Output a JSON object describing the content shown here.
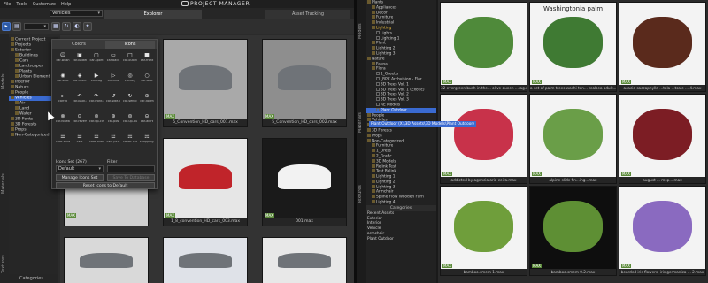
{
  "menu": [
    "File",
    "Tools",
    "Customize",
    "Help"
  ],
  "app_title": "PROJECT MANAGER",
  "tabs": [
    "Explorer",
    "Asset Tracking"
  ],
  "toolbar": {
    "project_select": "Vehicles",
    "action_glyph": "↻"
  },
  "side_tabs": {
    "models": "Models",
    "materials": "Materials",
    "textures": "Textures"
  },
  "left_tree": [
    {
      "label": "Current Project",
      "level": 0
    },
    {
      "label": "Projects",
      "level": 0
    },
    {
      "label": "Exterior",
      "level": 0
    },
    {
      "label": "Buildings",
      "level": 1
    },
    {
      "label": "Cars",
      "level": 1
    },
    {
      "label": "Landscapes",
      "level": 1
    },
    {
      "label": "Plants",
      "level": 1
    },
    {
      "label": "Urban Element",
      "level": 1
    },
    {
      "label": "Interior",
      "level": 0
    },
    {
      "label": "Nature",
      "level": 0
    },
    {
      "label": "People",
      "level": 0
    },
    {
      "label": "Vehicles",
      "level": 0,
      "selected": true
    },
    {
      "label": "Air",
      "level": 1
    },
    {
      "label": "Land",
      "level": 1
    },
    {
      "label": "Water",
      "level": 1
    },
    {
      "label": "3D Fonts",
      "level": 0
    },
    {
      "label": "3D Forests",
      "level": 0
    },
    {
      "label": "Props",
      "level": 0
    },
    {
      "label": "Non-Categorized",
      "level": 0
    }
  ],
  "icons_popup": {
    "tabs": [
      "Colors",
      "Icons"
    ],
    "cells": [
      {
        "g": "☺",
        "l": "car-wash"
      },
      {
        "g": "▣",
        "l": "car-battery"
      },
      {
        "g": "▢",
        "l": "car-sport"
      },
      {
        "g": "▭",
        "l": "car-back"
      },
      {
        "g": "□",
        "l": "car-outline"
      },
      {
        "g": "■",
        "l": "car-front"
      },
      {
        "g": "◉",
        "l": "car-side"
      },
      {
        "g": "◈",
        "l": "car-multi"
      },
      {
        "g": "▶",
        "l": "car-cog"
      },
      {
        "g": "▷",
        "l": "car-info"
      },
      {
        "g": "◎",
        "l": "car-key"
      },
      {
        "g": "○",
        "l": "car-sale"
      },
      {
        "g": "▸",
        "l": "carrot"
      },
      {
        "g": "↶",
        "l": "car-back-circle"
      },
      {
        "g": "↷",
        "l": "car-front-circle"
      },
      {
        "g": "↺",
        "l": "car-side-circle"
      },
      {
        "g": "↻",
        "l": "car-sett-circle"
      },
      {
        "g": "⊕",
        "l": "car-down"
      },
      {
        "g": "⊗",
        "l": "car-forward"
      },
      {
        "g": "⊙",
        "l": "car-reverse"
      },
      {
        "g": "⊚",
        "l": "car-up-circle"
      },
      {
        "g": "⊛",
        "l": "car-pos"
      },
      {
        "g": "⊜",
        "l": "car-up-outline"
      },
      {
        "g": "⊝",
        "l": "car-alert"
      },
      {
        "g": "☰",
        "l": "card-bullets"
      },
      {
        "g": "☱",
        "l": "cart"
      },
      {
        "g": "☲",
        "l": "card-outline"
      },
      {
        "g": "☳",
        "l": "cart-plus"
      },
      {
        "g": "☴",
        "l": "credit-card"
      },
      {
        "g": "☵",
        "l": "shopping-cart"
      }
    ],
    "icon_set_label": "Icons Set (267)",
    "icon_set_value": "Default",
    "filter_label": "Filter",
    "manage_button": "Manage Icons Set",
    "save_button": "Save To Database",
    "reset_button": "Reset Icons to Default"
  },
  "left_thumbs": [
    {
      "fn": "",
      "badge": "MAX",
      "tone": "#b9b9b9"
    },
    {
      "fn": "5_Convention_HD_cars_001.max",
      "badge": "MAX",
      "tone": "#a9a9a9"
    },
    {
      "fn": "5_Convention_HD_cars_002.max",
      "badge": "MAX",
      "tone": "#8e8e8e"
    },
    {
      "fn": "",
      "badge": "MAX",
      "tone": "#d0d0d0"
    },
    {
      "fn": "1_8_convention_HD_cars_003.max",
      "badge": "MAX",
      "tone": "#e6e6e6"
    },
    {
      "fn": "001.max",
      "badge": "MAX",
      "tone": "#1a1a1a"
    },
    {
      "fn": "",
      "badge": "",
      "tone": "#d9d9d9"
    },
    {
      "fn": "",
      "badge": "",
      "tone": "#dfe2e8"
    },
    {
      "fn": "",
      "badge": "",
      "tone": "#e8e8e8"
    }
  ],
  "categories_label": "Categories",
  "right_tree": [
    {
      "label": "Plants",
      "level": 0
    },
    {
      "label": "Appliances",
      "level": 1
    },
    {
      "label": "Decor",
      "level": 1
    },
    {
      "label": "Furniture",
      "level": 1
    },
    {
      "label": "Industrial",
      "level": 1
    },
    {
      "label": "Lighting",
      "level": 1,
      "hl": true
    },
    {
      "label": "Lights",
      "level": 2
    },
    {
      "label": "Lighting 1",
      "level": 2
    },
    {
      "label": "Plant",
      "level": 1
    },
    {
      "label": "Lighting 2",
      "level": 1
    },
    {
      "label": "Lighting 3",
      "level": 1
    },
    {
      "label": "Nature",
      "level": 0
    },
    {
      "label": "Fauna",
      "level": 1
    },
    {
      "label": "Flora",
      "level": 1
    },
    {
      "label": "1_Greet's",
      "level": 2
    },
    {
      "label": "_RPC Archvision - Flor",
      "level": 2
    },
    {
      "label": "3D Trees Vol. 1",
      "level": 2
    },
    {
      "label": "3D Trees Vol. 1 (Exotic)",
      "level": 2
    },
    {
      "label": "3D Trees Vol. 2",
      "level": 2
    },
    {
      "label": "3D Trees Vol. 3",
      "level": 2
    },
    {
      "label": "AE Models",
      "level": 2
    },
    {
      "label": "Plant Outdoor",
      "level": 2,
      "selected": true
    },
    {
      "label": "People",
      "level": 0
    },
    {
      "label": "Vehicles",
      "level": 0
    },
    {
      "label": "3D Fonts",
      "level": 0
    },
    {
      "label": "3D Forests",
      "level": 0
    },
    {
      "label": "Props",
      "level": 0
    },
    {
      "label": "Non-Categorized",
      "level": 0
    },
    {
      "label": "Furniture",
      "level": 1
    },
    {
      "label": "1_Dress",
      "level": 1
    },
    {
      "label": "2_Grafic",
      "level": 1
    },
    {
      "label": "3D Models",
      "level": 1
    },
    {
      "label": "Relink Test",
      "level": 1
    },
    {
      "label": "Test Relink",
      "level": 1
    },
    {
      "label": "Lighting 1",
      "level": 1
    },
    {
      "label": "Lighting 2",
      "level": 1
    },
    {
      "label": "Lighting 3",
      "level": 1
    },
    {
      "label": "Armchair",
      "level": 1
    },
    {
      "label": "Spline Flow Wooden Furn",
      "level": 1
    },
    {
      "label": "Lighting 4",
      "level": 1
    }
  ],
  "path_tooltip": "Plant Outdoor    (X:\\3D Assets\\3D Models\\Plant Outdoor)",
  "right_categories": [
    "Recent Assets",
    "Exterior",
    "Interior",
    "Vehicle",
    "armchair",
    "Plant Outdoor"
  ],
  "right_thumbs": [
    {
      "fn": "32 evergreen bush in the... olive queen ...tag.max",
      "title": "",
      "dark": false
    },
    {
      "fn": "a set of palm trees washi ton... tealsea adult... 2.max",
      "title": "Washingtonia palm",
      "dark": false
    },
    {
      "fn": "acacia saccaphylla ...tala ...tsale ... 4.max",
      "title": "",
      "dark": false
    },
    {
      "fn": "addicted by agencia aria ceira.max",
      "title": "",
      "dark": false
    },
    {
      "fn": "alpine slide fin...ing...max",
      "title": "",
      "dark": false
    },
    {
      "fn": "august ... msp....max",
      "title": "",
      "dark": false
    },
    {
      "fn": "bamboo.smem 1.max",
      "title": "",
      "dark": false
    },
    {
      "fn": "bamboo.smem 0.2.max",
      "title": "",
      "dark": true
    },
    {
      "fn": "bearded iris flowers, iris germanica ... 2.max",
      "title": "",
      "dark": false
    }
  ]
}
